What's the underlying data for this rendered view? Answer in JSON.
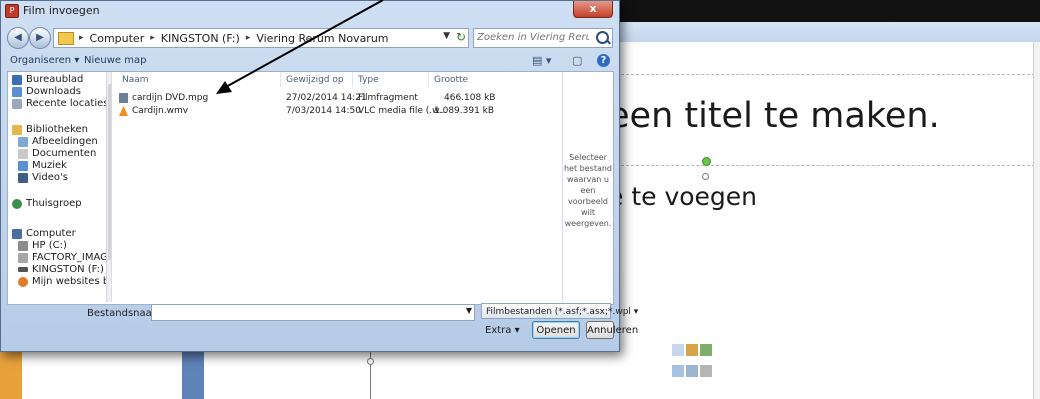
{
  "dialog": {
    "title": "Film invoegen",
    "close_label": "x",
    "address": {
      "crumbs": [
        "Computer",
        "KINGSTON (F:)",
        "Viering Rerum Novarum"
      ],
      "separator": "▸"
    },
    "search_placeholder": "Zoeken in Viering Rerum Nova...",
    "toolbar": {
      "organize_label": "Organiseren ▾",
      "new_folder_label": "Nieuwe map"
    },
    "nav_items": [
      {
        "label": "Bureaublad",
        "icon": "desktop-icon"
      },
      {
        "label": "Downloads",
        "icon": "downloads-icon"
      },
      {
        "label": "Recente locaties",
        "icon": "recent-places-icon"
      },
      {
        "label": "Bibliotheken",
        "icon": "libraries-icon"
      },
      {
        "label": "Afbeeldingen",
        "icon": "pictures-icon"
      },
      {
        "label": "Documenten",
        "icon": "documents-icon"
      },
      {
        "label": "Muziek",
        "icon": "music-icon"
      },
      {
        "label": "Video's",
        "icon": "videos-icon"
      },
      {
        "label": "Thuisgroep",
        "icon": "homegroup-icon"
      },
      {
        "label": "Computer",
        "icon": "computer-icon"
      },
      {
        "label": "HP (C:)",
        "icon": "drive-icon"
      },
      {
        "label": "FACTORY_IMAGE",
        "icon": "drive-icon"
      },
      {
        "label": "KINGSTON (F:)",
        "icon": "usb-drive-icon"
      },
      {
        "label": "Mijn websites bij",
        "icon": "websites-icon"
      }
    ],
    "columns": [
      "Naam",
      "Gewijzigd op",
      "Type",
      "Grootte"
    ],
    "files": [
      {
        "name": "cardijn DVD.mpg",
        "modified": "27/02/2014 14:21",
        "type": "Filmfragment",
        "size": "466.108 kB",
        "icon": "video-file-icon"
      },
      {
        "name": "Cardijn.wmv",
        "modified": "7/03/2014 14:50",
        "type": "VLC media file (.w...",
        "size": "1.089.391 kB",
        "icon": "vlc-file-icon"
      }
    ],
    "preview_text": [
      "Selecteer",
      "het bestand",
      "waarvan u",
      "een",
      "voorbeeld",
      "wilt",
      "weergeven."
    ],
    "filename_label": "Bestandsnaam:",
    "filename_value": "",
    "filter_value": "Filmbestanden (*.asf;*.asx;*.wpl ▾",
    "extra_label": "Extra  ▾",
    "open_label": "Openen",
    "cancel_label": "Annuleren"
  },
  "slide": {
    "title_text": "een titel te maken.",
    "body_text": "e te voegen"
  },
  "colors": {
    "frame": "#111111",
    "accent_orange": "#e8a23c",
    "dialog_chrome": "#c3d6ee",
    "close_red": "#c4402a",
    "handle_green": "#6cc24a"
  }
}
